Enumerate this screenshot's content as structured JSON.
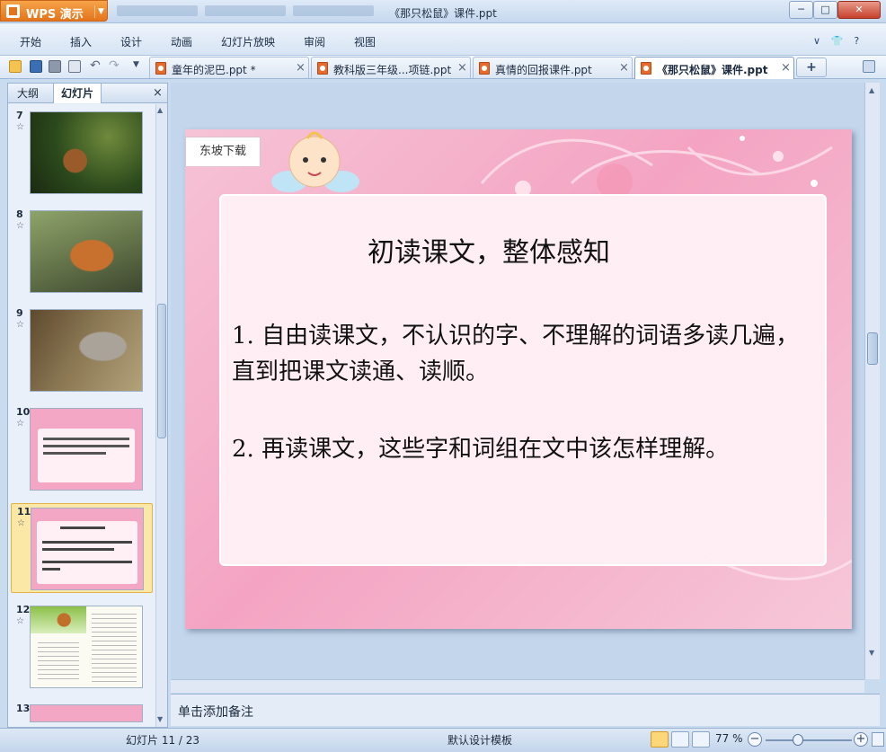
{
  "app": {
    "name": "WPS 演示"
  },
  "window": {
    "title": "《那只松鼠》课件.ppt",
    "min": "─",
    "max": "□",
    "close": "✕"
  },
  "menu": {
    "items": [
      "开始",
      "插入",
      "设计",
      "动画",
      "幻灯片放映",
      "审阅",
      "视图"
    ],
    "right_icons": [
      "chevron-down-icon",
      "shirt-icon",
      "help-icon"
    ],
    "right_glyphs": {
      "collapse": "∨",
      "skin": "👕",
      "help": "?"
    }
  },
  "toolbar": {
    "icons": [
      "open-icon",
      "save-icon",
      "print-icon",
      "print-preview-icon",
      "undo-icon",
      "redo-icon",
      "customize-icon"
    ]
  },
  "tabs": [
    {
      "label": "童年的泥巴.ppt *",
      "active": false
    },
    {
      "label": "教科版三年级...项链.ppt",
      "active": false
    },
    {
      "label": "真情的回报课件.ppt",
      "active": false
    },
    {
      "label": "《那只松鼠》课件.ppt",
      "active": true
    }
  ],
  "tab_controls": {
    "close": "×",
    "add": "+"
  },
  "left_pane": {
    "tabs": [
      "大纲",
      "幻灯片"
    ],
    "active_tab": "幻灯片",
    "close": "×",
    "star": "☆",
    "thumbnails": [
      {
        "number": "7",
        "kind": "photo"
      },
      {
        "number": "8",
        "kind": "photo"
      },
      {
        "number": "9",
        "kind": "photo"
      },
      {
        "number": "10",
        "kind": "pink-text"
      },
      {
        "number": "11",
        "kind": "pink-text",
        "selected": true
      },
      {
        "number": "12",
        "kind": "document"
      },
      {
        "number": "13",
        "kind": "pink-text"
      }
    ],
    "scroll_up": "▲",
    "scroll_down": "▼"
  },
  "slide": {
    "watermark": "东坡下载",
    "heading": "初读课文，整体感知",
    "bullets": [
      "1. 自由读课文，不认识的字、不理解的词语多读几遍，直到把课文读通、读顺。",
      "2. 再读课文，这些字和词组在文中该怎样理解。"
    ]
  },
  "notes": {
    "placeholder": "单击添加备注"
  },
  "status": {
    "slide_indicator": "幻灯片 11 / 23",
    "template": "默认设计模板",
    "zoom": "77 %",
    "zoom_minus": "−",
    "zoom_plus": "+"
  },
  "colors": {
    "accent": "#e4741a",
    "slide_pink": "#f4a4c2",
    "ribbon": "#d6e4f4"
  }
}
